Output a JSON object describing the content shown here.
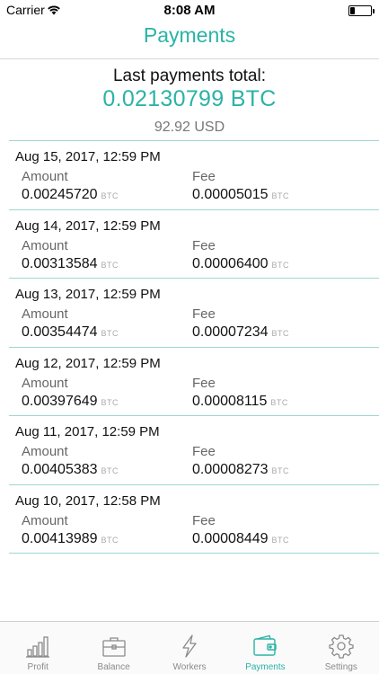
{
  "status_bar": {
    "carrier": "Carrier",
    "time": "8:08 AM",
    "battery_level": 0.22
  },
  "nav": {
    "title": "Payments"
  },
  "summary": {
    "label": "Last payments total:",
    "btc_total": "0.02130799 BTC",
    "usd_total": "92.92 USD"
  },
  "columns": {
    "amount_label": "Amount",
    "fee_label": "Fee",
    "unit": "BTC"
  },
  "payments": [
    {
      "date": "Aug 15, 2017, 12:59 PM",
      "amount": "0.00245720",
      "fee": "0.00005015"
    },
    {
      "date": "Aug 14, 2017, 12:59 PM",
      "amount": "0.00313584",
      "fee": "0.00006400"
    },
    {
      "date": "Aug 13, 2017, 12:59 PM",
      "amount": "0.00354474",
      "fee": "0.00007234"
    },
    {
      "date": "Aug 12, 2017, 12:59 PM",
      "amount": "0.00397649",
      "fee": "0.00008115"
    },
    {
      "date": "Aug 11, 2017, 12:59 PM",
      "amount": "0.00405383",
      "fee": "0.00008273"
    },
    {
      "date": "Aug 10, 2017, 12:58 PM",
      "amount": "0.00413989",
      "fee": "0.00008449"
    }
  ],
  "tabs": [
    {
      "label": "Profit",
      "icon": "bar-chart-icon",
      "active": false
    },
    {
      "label": "Balance",
      "icon": "briefcase-icon",
      "active": false
    },
    {
      "label": "Workers",
      "icon": "lightning-icon",
      "active": false
    },
    {
      "label": "Payments",
      "icon": "wallet-icon",
      "active": true
    },
    {
      "label": "Settings",
      "icon": "gear-icon",
      "active": false
    }
  ],
  "colors": {
    "accent": "#2ab3a6",
    "divider": "#9ed7d0",
    "inactive": "#8a8a8a"
  }
}
